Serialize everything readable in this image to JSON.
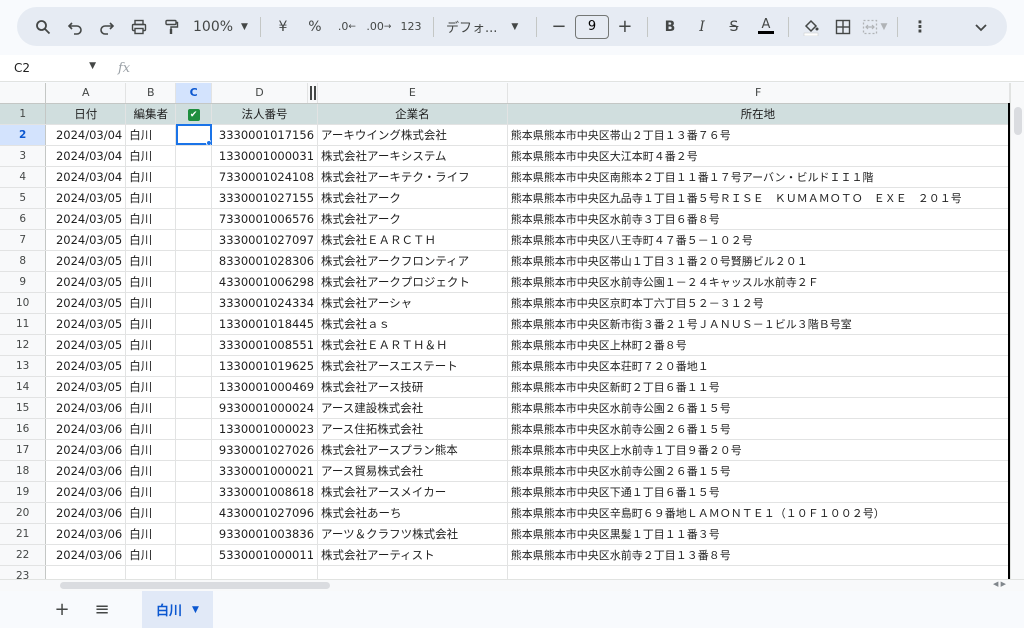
{
  "toolbar": {
    "zoom": "100%",
    "currency": "¥",
    "percent": "%",
    "decimal_decrease": ".0",
    "decimal_increase": ".00",
    "format_123": "123",
    "font": "デフォ...",
    "font_size": "9",
    "icons": [
      "search-icon",
      "undo-icon",
      "redo-icon",
      "print-icon",
      "paint-format-icon",
      "bold-icon",
      "italic-icon",
      "strikethrough-icon",
      "text-color-icon",
      "fill-color-icon",
      "borders-icon",
      "merge-icon",
      "more-icon",
      "collapse-icon"
    ]
  },
  "formula_bar": {
    "cell_ref": "C2",
    "fx": "fx",
    "value": ""
  },
  "columns": [
    "A",
    "B",
    "C",
    "D",
    "",
    "E",
    "F"
  ],
  "selected_column": "C",
  "header_row": {
    "row": "1",
    "a": "日付",
    "b": "編集者",
    "c": "✔",
    "d": "法人番号",
    "e": "企業名",
    "f": "所在地"
  },
  "rows": [
    {
      "n": "2",
      "date": "2024/03/04",
      "editor": "白川",
      "num": "3330001017156",
      "company": "アーキウイング株式会社",
      "addr": "熊本県熊本市中央区帯山２丁目１３番７６号"
    },
    {
      "n": "3",
      "date": "2024/03/04",
      "editor": "白川",
      "num": "1330001000031",
      "company": "株式会社アーキシステム",
      "addr": "熊本県熊本市中央区大江本町４番２号"
    },
    {
      "n": "4",
      "date": "2024/03/04",
      "editor": "白川",
      "num": "7330001024108",
      "company": "株式会社アーキテク・ライフ",
      "addr": "熊本県熊本市中央区南熊本２丁目１１番１７号アーバン・ビルドＩＩ１階"
    },
    {
      "n": "5",
      "date": "2024/03/05",
      "editor": "白川",
      "num": "3330001027155",
      "company": "株式会社アーク",
      "addr": "熊本県熊本市中央区九品寺１丁目１番５号ＲＩＳＥ　ＫＵＭＡＭＯＴＯ　ＥＸＥ　２０１号"
    },
    {
      "n": "6",
      "date": "2024/03/05",
      "editor": "白川",
      "num": "7330001006576",
      "company": "株式会社アーク",
      "addr": "熊本県熊本市中央区水前寺３丁目６番８号"
    },
    {
      "n": "7",
      "date": "2024/03/05",
      "editor": "白川",
      "num": "3330001027097",
      "company": "株式会社ＥＡＲＣＴＨ",
      "addr": "熊本県熊本市中央区八王寺町４７番５－１０２号"
    },
    {
      "n": "8",
      "date": "2024/03/05",
      "editor": "白川",
      "num": "8330001028306",
      "company": "株式会社アークフロンティア",
      "addr": "熊本県熊本市中央区帯山１丁目３１番２０号賢勝ビル２０１"
    },
    {
      "n": "9",
      "date": "2024/03/05",
      "editor": "白川",
      "num": "4330001006298",
      "company": "株式会社アークプロジェクト",
      "addr": "熊本県熊本市中央区水前寺公園１－２４キャッスル水前寺２Ｆ"
    },
    {
      "n": "10",
      "date": "2024/03/05",
      "editor": "白川",
      "num": "3330001024334",
      "company": "株式会社アーシャ",
      "addr": "熊本県熊本市中央区京町本丁六丁目５２－３１２号"
    },
    {
      "n": "11",
      "date": "2024/03/05",
      "editor": "白川",
      "num": "1330001018445",
      "company": "株式会社ａｓ",
      "addr": "熊本県熊本市中央区新市街３番２１号ＪＡＮＵＳ－１ビル３階Ｂ号室"
    },
    {
      "n": "12",
      "date": "2024/03/05",
      "editor": "白川",
      "num": "3330001008551",
      "company": "株式会社ＥＡＲＴＨ＆Ｈ",
      "addr": "熊本県熊本市中央区上林町２番８号"
    },
    {
      "n": "13",
      "date": "2024/03/05",
      "editor": "白川",
      "num": "1330001019625",
      "company": "株式会社アースエステート",
      "addr": "熊本県熊本市中央区本荘町７２０番地１"
    },
    {
      "n": "14",
      "date": "2024/03/05",
      "editor": "白川",
      "num": "1330001000469",
      "company": "株式会社アース技研",
      "addr": "熊本県熊本市中央区新町２丁目６番１１号"
    },
    {
      "n": "15",
      "date": "2024/03/06",
      "editor": "白川",
      "num": "9330001000024",
      "company": "アース建設株式会社",
      "addr": "熊本県熊本市中央区水前寺公園２６番１５号"
    },
    {
      "n": "16",
      "date": "2024/03/06",
      "editor": "白川",
      "num": "1330001000023",
      "company": "アース住拓株式会社",
      "addr": "熊本県熊本市中央区水前寺公園２６番１５号"
    },
    {
      "n": "17",
      "date": "2024/03/06",
      "editor": "白川",
      "num": "9330001027026",
      "company": "株式会社アースプラン熊本",
      "addr": "熊本県熊本市中央区上水前寺１丁目９番２０号"
    },
    {
      "n": "18",
      "date": "2024/03/06",
      "editor": "白川",
      "num": "3330001000021",
      "company": "アース貿易株式会社",
      "addr": "熊本県熊本市中央区水前寺公園２６番１５号"
    },
    {
      "n": "19",
      "date": "2024/03/06",
      "editor": "白川",
      "num": "3330001008618",
      "company": "株式会社アースメイカー",
      "addr": "熊本県熊本市中央区下通１丁目６番１５号"
    },
    {
      "n": "20",
      "date": "2024/03/06",
      "editor": "白川",
      "num": "4330001027096",
      "company": "株式会社あーち",
      "addr": "熊本県熊本市中央区辛島町６９番地ＬＡＭＯＮＴＥ１（１０Ｆ１００２号）"
    },
    {
      "n": "21",
      "date": "2024/03/06",
      "editor": "白川",
      "num": "9330001003836",
      "company": "アーツ＆クラフツ株式会社",
      "addr": "熊本県熊本市中央区黒髪１丁目１１番３号"
    },
    {
      "n": "22",
      "date": "2024/03/06",
      "editor": "白川",
      "num": "5330001000011",
      "company": "株式会社アーティスト",
      "addr": "熊本県熊本市中央区水前寺２丁目１３番８号"
    }
  ],
  "partial_row": {
    "n": "23"
  },
  "sheet_tab": {
    "add": "+",
    "list": "≡",
    "name": "白川"
  }
}
